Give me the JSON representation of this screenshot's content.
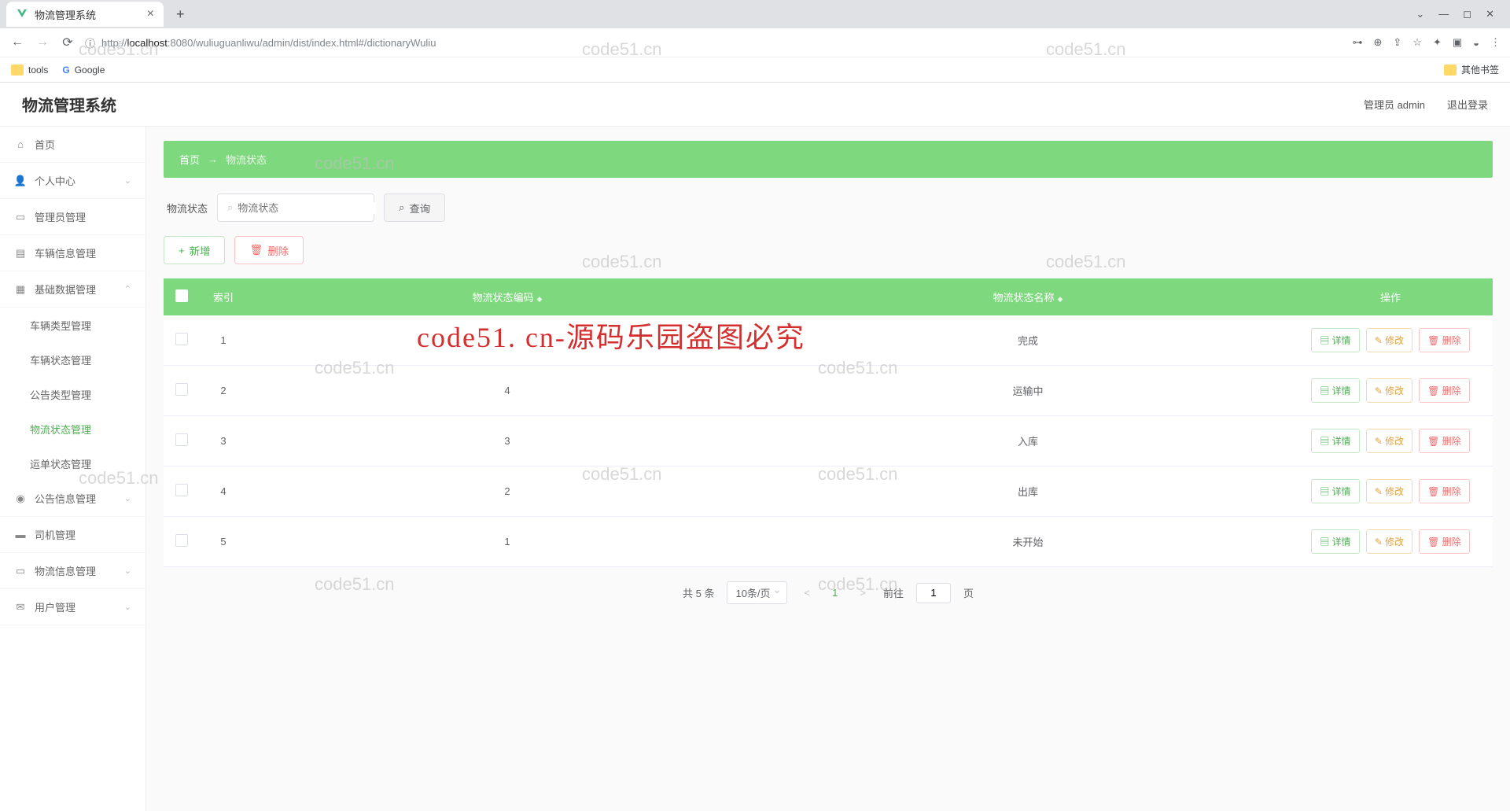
{
  "browser": {
    "tab_title": "物流管理系统",
    "url_prefix": "http://",
    "url_host": "localhost",
    "url_port": ":8080",
    "url_path": "/wuliuguanliwu/admin/dist/index.html#/dictionaryWuliu",
    "bookmarks": {
      "tools": "tools",
      "google": "Google",
      "other": "其他书签"
    }
  },
  "app": {
    "title": "物流管理系统",
    "user_label": "管理员 admin",
    "logout": "退出登录"
  },
  "sidebar": {
    "items": [
      {
        "label": "首页"
      },
      {
        "label": "个人中心"
      },
      {
        "label": "管理员管理"
      },
      {
        "label": "车辆信息管理"
      },
      {
        "label": "基础数据管理"
      },
      {
        "label": "公告信息管理"
      },
      {
        "label": "司机管理"
      },
      {
        "label": "物流信息管理"
      },
      {
        "label": "用户管理"
      }
    ],
    "subs": [
      "车辆类型管理",
      "车辆状态管理",
      "公告类型管理",
      "物流状态管理",
      "运单状态管理"
    ]
  },
  "breadcrumb": {
    "home": "首页",
    "current": "物流状态"
  },
  "filter": {
    "label": "物流状态",
    "placeholder": "物流状态",
    "query": "查询"
  },
  "actions": {
    "add": "新增",
    "delete": "删除"
  },
  "table": {
    "headers": [
      "",
      "索引",
      "物流状态编码",
      "物流状态名称",
      "操作"
    ],
    "ops": {
      "detail": "详情",
      "edit": "修改",
      "del": "删除"
    },
    "rows": [
      {
        "idx": "1",
        "code": "",
        "name": "完成"
      },
      {
        "idx": "2",
        "code": "4",
        "name": "运输中"
      },
      {
        "idx": "3",
        "code": "3",
        "name": "入库"
      },
      {
        "idx": "4",
        "code": "2",
        "name": "出库"
      },
      {
        "idx": "5",
        "code": "1",
        "name": "未开始"
      }
    ]
  },
  "pagination": {
    "total": "共 5 条",
    "per_page": "10条/页",
    "current": "1",
    "goto_prefix": "前往",
    "goto_suffix": "页",
    "goto_value": "1"
  },
  "watermarks": [
    "code51.cn",
    "code51.cn",
    "code51.cn",
    "code51.cn",
    "code51.cn",
    "code51.cn",
    "code51.cn",
    "code51.cn",
    "code51.cn",
    "code51.cn"
  ],
  "big_watermark": "code51. cn-源码乐园盗图必究"
}
